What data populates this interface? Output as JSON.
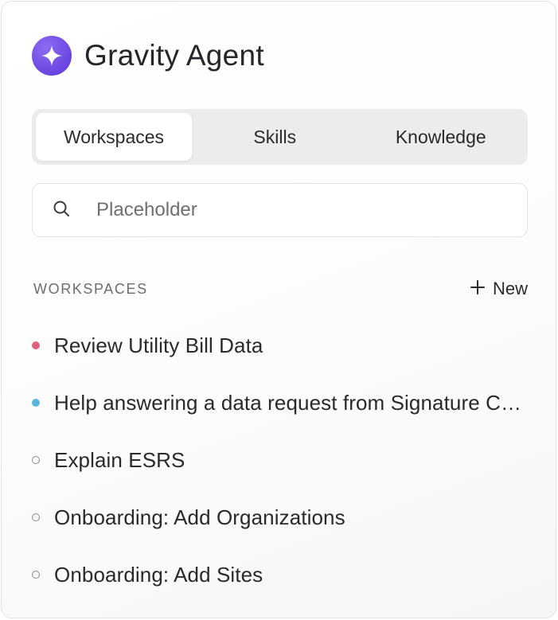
{
  "app": {
    "title": "Gravity Agent",
    "brand_color": "#6a45e0"
  },
  "tabs": [
    {
      "label": "Workspaces",
      "active": true
    },
    {
      "label": "Skills",
      "active": false
    },
    {
      "label": "Knowledge",
      "active": false
    }
  ],
  "search": {
    "placeholder": "Placeholder",
    "value": "",
    "icon": "search-icon"
  },
  "workspaces": {
    "section_title": "WORKSPACES",
    "new_label": "New",
    "new_icon": "plus-icon",
    "items": [
      {
        "label": "Review Utility Bill Data",
        "dot": "filled",
        "color": "#e0607e"
      },
      {
        "label": "Help answering a data request from Signature Company",
        "dot": "filled",
        "color": "#5ab4e0"
      },
      {
        "label": "Explain ESRS",
        "dot": "ring",
        "color": "#8a8a90"
      },
      {
        "label": "Onboarding: Add Organizations",
        "dot": "ring",
        "color": "#8a8a90"
      },
      {
        "label": "Onboarding: Add Sites",
        "dot": "ring",
        "color": "#8a8a90"
      }
    ]
  }
}
